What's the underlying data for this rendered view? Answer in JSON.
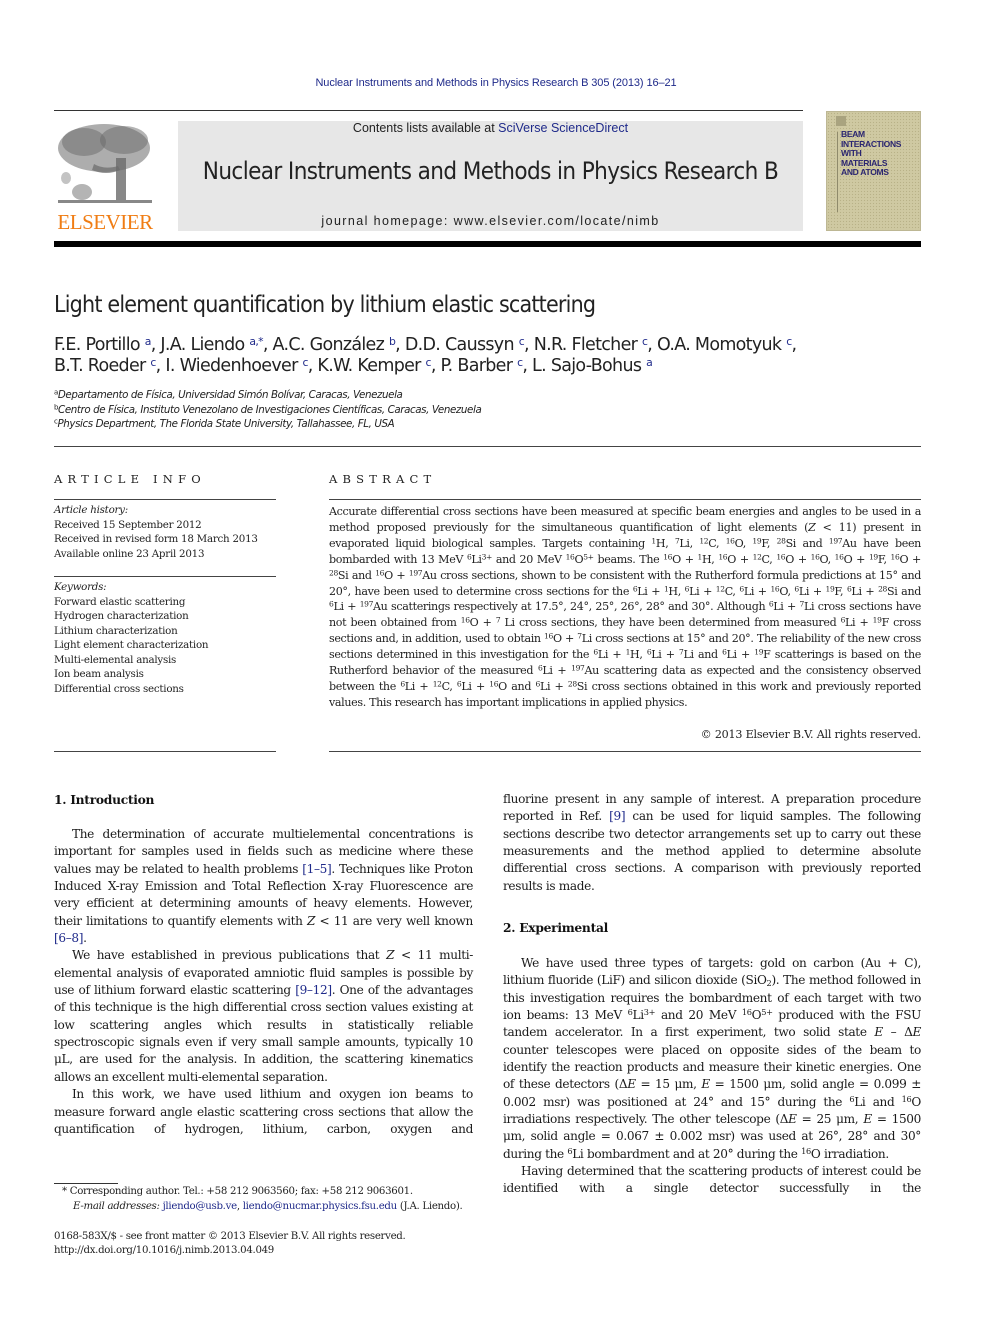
{
  "header": {
    "citation": "Nuclear Instruments and Methods in Physics Research B 305 (2013) 16–21",
    "contents_prefix": "Contents lists available at ",
    "contents_link": "SciVerse ScienceDirect",
    "journal_name": "Nuclear Instruments and Methods in Physics Research B",
    "homepage": "journal homepage: www.elsevier.com/locate/nimb",
    "publisher_logo_text": "ELSEVIER",
    "cover_title": "BEAM\nINTERACTIONS\nWITH\nMATERIALS\nAND ATOMS",
    "colors": {
      "link": "#1f2a8a",
      "elsevier_orange": "#f07d14",
      "banner_bg": "#e7e7e7",
      "cover_bg": "#cfc9a2"
    }
  },
  "article": {
    "title": "Light element quantification by lithium elastic scattering",
    "authors_line1": [
      {
        "t": "F.E. Portillo "
      },
      {
        "sup": "a"
      },
      {
        "t": ", J.A. Liendo "
      },
      {
        "sup": "a,*"
      },
      {
        "t": ", A.C. González "
      },
      {
        "sup": "b"
      },
      {
        "t": ", D.D. Caussyn "
      },
      {
        "sup": "c"
      },
      {
        "t": ", N.R. Fletcher "
      },
      {
        "sup": "c"
      },
      {
        "t": ", O.A. Momotyuk "
      },
      {
        "sup": "c"
      },
      {
        "t": ","
      }
    ],
    "authors_line2": [
      {
        "t": "B.T. Roeder "
      },
      {
        "sup": "c"
      },
      {
        "t": ", I. Wiedenhoever "
      },
      {
        "sup": "c"
      },
      {
        "t": ", K.W. Kemper "
      },
      {
        "sup": "c"
      },
      {
        "t": ", P. Barber "
      },
      {
        "sup": "c"
      },
      {
        "t": ", L. Sajo-Bohus "
      },
      {
        "sup": "a"
      }
    ],
    "affiliations": [
      {
        "mark": "a",
        "text": "Departamento de Física, Universidad Simón Bolívar, Caracas, Venezuela"
      },
      {
        "mark": "b",
        "text": "Centro de Física, Instituto Venezolano de Investigaciones Científicas, Caracas, Venezuela"
      },
      {
        "mark": "c",
        "text": "Physics Department, The Florida State University, Tallahassee, FL, USA"
      }
    ]
  },
  "article_info": {
    "heading": "ARTICLE INFO",
    "history_label": "Article history:",
    "history": [
      "Received 15 September 2012",
      "Received in revised form 18 March 2013",
      "Available online 23 April 2013"
    ],
    "keywords_label": "Keywords:",
    "keywords": [
      "Forward elastic scattering",
      "Hydrogen characterization",
      "Lithium characterization",
      "Light element characterization",
      "Multi-elemental analysis",
      "Ion beam analysis",
      "Differential cross sections"
    ]
  },
  "abstract": {
    "heading": "ABSTRACT",
    "body": [
      {
        "t": "Accurate differential cross sections have been measured at specific beam energies and angles to be used in a method proposed previously for the simultaneous quantification of light elements ("
      },
      {
        "i": "Z"
      },
      {
        "t": " < 11) present in evaporated liquid biological samples. Targets containing "
      },
      {
        "sup": "1"
      },
      {
        "t": "H, "
      },
      {
        "sup": "7"
      },
      {
        "t": "Li, "
      },
      {
        "sup": "12"
      },
      {
        "t": "C, "
      },
      {
        "sup": "16"
      },
      {
        "t": "O, "
      },
      {
        "sup": "19"
      },
      {
        "t": "F, "
      },
      {
        "sup": "28"
      },
      {
        "t": "Si and "
      },
      {
        "sup": "197"
      },
      {
        "t": "Au have been bombarded with 13 MeV "
      },
      {
        "sup": "6"
      },
      {
        "t": "Li"
      },
      {
        "sup": "3+"
      },
      {
        "t": " and 20 MeV "
      },
      {
        "sup": "16"
      },
      {
        "t": "O"
      },
      {
        "sup": "5+"
      },
      {
        "t": " beams. The "
      },
      {
        "sup": "16"
      },
      {
        "t": "O + "
      },
      {
        "sup": "1"
      },
      {
        "t": "H, "
      },
      {
        "sup": "16"
      },
      {
        "t": "O + "
      },
      {
        "sup": "12"
      },
      {
        "t": "C, "
      },
      {
        "sup": "16"
      },
      {
        "t": "O + "
      },
      {
        "sup": "16"
      },
      {
        "t": "O, "
      },
      {
        "sup": "16"
      },
      {
        "t": "O + "
      },
      {
        "sup": "19"
      },
      {
        "t": "F, "
      },
      {
        "sup": "16"
      },
      {
        "t": "O + "
      },
      {
        "sup": "28"
      },
      {
        "t": "Si and "
      },
      {
        "sup": "16"
      },
      {
        "t": "O + "
      },
      {
        "sup": "197"
      },
      {
        "t": "Au cross sections, shown to be consistent with the Rutherford formula predictions at 15° and 20°, have been used to determine cross sections for the "
      },
      {
        "sup": "6"
      },
      {
        "t": "Li + "
      },
      {
        "sup": "1"
      },
      {
        "t": "H, "
      },
      {
        "sup": "6"
      },
      {
        "t": "Li + "
      },
      {
        "sup": "12"
      },
      {
        "t": "C, "
      },
      {
        "sup": "6"
      },
      {
        "t": "Li + "
      },
      {
        "sup": "16"
      },
      {
        "t": "O, "
      },
      {
        "sup": "6"
      },
      {
        "t": "Li + "
      },
      {
        "sup": "19"
      },
      {
        "t": "F, "
      },
      {
        "sup": "6"
      },
      {
        "t": "Li + "
      },
      {
        "sup": "28"
      },
      {
        "t": "Si and "
      },
      {
        "sup": "6"
      },
      {
        "t": "Li + "
      },
      {
        "sup": "197"
      },
      {
        "t": "Au scatterings respectively at 17.5°, 24°, 25°, 26°, 28° and 30°. Although "
      },
      {
        "sup": "6"
      },
      {
        "t": "Li + "
      },
      {
        "sup": "7"
      },
      {
        "t": "Li cross sections have not been obtained from "
      },
      {
        "sup": "16"
      },
      {
        "t": "O + "
      },
      {
        "sup": "7"
      },
      {
        "t": " Li cross sections, they have been determined from measured "
      },
      {
        "sup": "6"
      },
      {
        "t": "Li + "
      },
      {
        "sup": "19"
      },
      {
        "t": "F cross sections and, in addition, used to obtain "
      },
      {
        "sup": "16"
      },
      {
        "t": "O + "
      },
      {
        "sup": "7"
      },
      {
        "t": "Li cross sections at 15° and 20°. The reliability of the new cross sections determined in this investigation for the "
      },
      {
        "sup": "6"
      },
      {
        "t": "Li + "
      },
      {
        "sup": "1"
      },
      {
        "t": "H, "
      },
      {
        "sup": "6"
      },
      {
        "t": "Li + "
      },
      {
        "sup": "7"
      },
      {
        "t": "Li and "
      },
      {
        "sup": "6"
      },
      {
        "t": "Li + "
      },
      {
        "sup": "19"
      },
      {
        "t": "F scatterings is based on the Rutherford behavior of the measured "
      },
      {
        "sup": "6"
      },
      {
        "t": "Li + "
      },
      {
        "sup": "197"
      },
      {
        "t": "Au scattering data as expected and the consistency observed between the "
      },
      {
        "sup": "6"
      },
      {
        "t": "Li + "
      },
      {
        "sup": "12"
      },
      {
        "t": "C, "
      },
      {
        "sup": "6"
      },
      {
        "t": "Li + "
      },
      {
        "sup": "16"
      },
      {
        "t": "O and "
      },
      {
        "sup": "6"
      },
      {
        "t": "Li + "
      },
      {
        "sup": "28"
      },
      {
        "t": "Si cross sections obtained in this work and previously reported values. This research has important implications in applied physics."
      }
    ],
    "copyright": "© 2013 Elsevier B.V. All rights reserved."
  },
  "body": {
    "intro_heading": "1. Introduction",
    "intro_paragraphs": [
      [
        {
          "t": "The determination of accurate multielemental concentrations is important for samples used in fields such as medicine where these values may be related to health problems "
        },
        {
          "link": "[1–5]"
        },
        {
          "t": ". Techniques like Proton Induced X-ray Emission and Total Reflection X-ray Fluorescence are very efficient at determining amounts of heavy elements. However, their limitations to quantify elements with "
        },
        {
          "i": "Z"
        },
        {
          "t": " < 11 are very well known "
        },
        {
          "link": "[6–8]"
        },
        {
          "t": "."
        }
      ],
      [
        {
          "t": "We have established in previous publications that "
        },
        {
          "i": "Z"
        },
        {
          "t": " < 11 multi-elemental analysis of evaporated amniotic fluid samples is possible by use of lithium forward elastic scattering "
        },
        {
          "link": "[9–12]"
        },
        {
          "t": ". One of the advantages of this technique is the high differential cross section values existing at low scattering angles which results in statistically reliable spectroscopic signals even if very small sample amounts, typically 10 μL, are used for the analysis. In addition, the scattering kinematics allows an excellent multi-elemental separation."
        }
      ],
      [
        {
          "t": "In this work, we have used lithium and oxygen ion beams to measure forward angle elastic scattering cross sections that allow the quantification of hydrogen, lithium, carbon, oxygen and"
        }
      ]
    ],
    "intro_continued": [
      {
        "t": "fluorine present in any sample of interest. A preparation procedure reported in Ref. "
      },
      {
        "link": "[9]"
      },
      {
        "t": " can be used for liquid samples. The following sections describe two detector arrangements set up to carry out these measurements and the method applied to determine absolute differential cross sections. A comparison with previously reported results is made."
      }
    ],
    "exp_heading": "2. Experimental",
    "exp_paragraphs": [
      [
        {
          "t": "We have used three types of targets: gold on carbon (Au + C), lithium fluoride (LiF) and silicon dioxide (SiO"
        },
        {
          "sub": "2"
        },
        {
          "t": "). The method followed in this investigation requires the bombardment of each target with two ion beams: 13 MeV "
        },
        {
          "sup": "6"
        },
        {
          "t": "Li"
        },
        {
          "sup": "3+"
        },
        {
          "t": " and 20 MeV "
        },
        {
          "sup": "16"
        },
        {
          "t": "O"
        },
        {
          "sup": "5+"
        },
        {
          "t": " produced with the FSU tandem accelerator. In a first experiment, two solid state "
        },
        {
          "i": "E"
        },
        {
          "t": " – Δ"
        },
        {
          "i": "E"
        },
        {
          "t": " counter telescopes were placed on opposite sides of the beam to identify the reaction products and measure their kinetic energies. One of these detectors (Δ"
        },
        {
          "i": "E"
        },
        {
          "t": " = 15 μm, "
        },
        {
          "i": "E"
        },
        {
          "t": " = 1500 μm, solid angle = 0.099 ± 0.002 msr) was positioned at 24° and 15° during the "
        },
        {
          "sup": "6"
        },
        {
          "t": "Li and "
        },
        {
          "sup": "16"
        },
        {
          "t": "O irradiations respectively. The other telescope (Δ"
        },
        {
          "i": "E"
        },
        {
          "t": " = 25 μm, "
        },
        {
          "i": "E"
        },
        {
          "t": " = 1500 μm, solid angle = 0.067 ± 0.002 msr) was used at 26°, 28° and 30° during the "
        },
        {
          "sup": "6"
        },
        {
          "t": "Li bombardment and at 20° during the "
        },
        {
          "sup": "16"
        },
        {
          "t": "O irradiation."
        }
      ],
      [
        {
          "t": "Having determined that the scattering products of interest could be identified with a single detector successfully in the"
        }
      ]
    ]
  },
  "footnotes": {
    "corresponding": "* Corresponding author. Tel.: +58 212 9063560; fax: +58 212 9063601.",
    "email_label": "E-mail addresses: ",
    "email_1": "jliendo@usb.ve",
    "email_sep": ", ",
    "email_2": "liendo@nucmar.physics.fsu.edu",
    "email_suffix": " (J.A. Liendo).",
    "issn": "0168-583X/$ - see front matter © 2013 Elsevier B.V. All rights reserved.",
    "doi": "http://dx.doi.org/10.1016/j.nimb.2013.04.049"
  }
}
